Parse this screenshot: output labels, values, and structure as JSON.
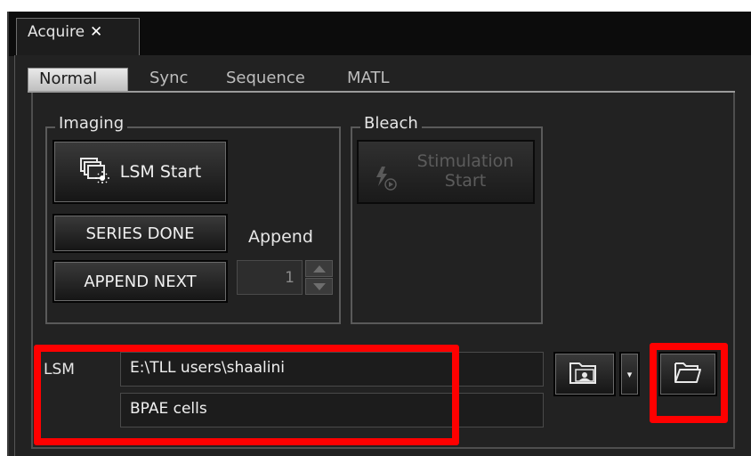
{
  "window": {
    "tab_title": "Acquire",
    "tab_close": "✕"
  },
  "subtabs": [
    "Normal",
    "Sync",
    "Sequence",
    "MATL"
  ],
  "imaging": {
    "title": "Imaging",
    "lsm_start_label": "LSM Start",
    "series_done_label": "SERIES DONE",
    "append_next_label": "APPEND NEXT",
    "append_label": "Append",
    "append_value": "1"
  },
  "bleach": {
    "title": "Bleach",
    "stimulation_line1": "Stimulation",
    "stimulation_line2": "Start"
  },
  "lsm": {
    "label": "LSM",
    "path_value": "E:\\TLL users\\shaalini",
    "name_value": "BPAE cells",
    "dropdown_glyph": "▾"
  },
  "icons": {
    "lsm_start": "stacked-windows-icon",
    "stimulation": "lightning-play-icon",
    "image_folder": "folder-image-icon",
    "folder": "open-folder-icon"
  },
  "colors": {
    "background": "#222222",
    "highlight": "#ff0000",
    "active_tab": "#d6d6d6"
  }
}
